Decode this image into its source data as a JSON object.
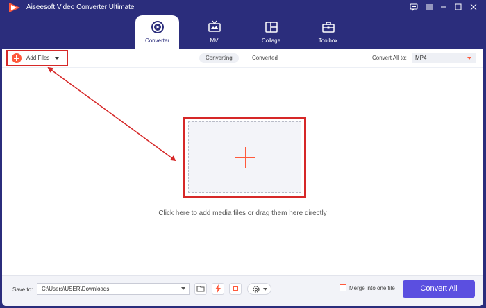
{
  "app": {
    "title": "Aiseesoft Video Converter Ultimate"
  },
  "window_controls": [
    "feedback-icon",
    "menu-icon",
    "minimize-icon",
    "maximize-icon",
    "close-icon"
  ],
  "nav": {
    "tabs": [
      {
        "label": "Converter",
        "icon": "converter-icon",
        "active": true
      },
      {
        "label": "MV",
        "icon": "tv-icon",
        "active": false
      },
      {
        "label": "Collage",
        "icon": "collage-icon",
        "active": false
      },
      {
        "label": "Toolbox",
        "icon": "toolbox-icon",
        "active": false
      }
    ]
  },
  "toolbar": {
    "add_files_label": "Add Files",
    "segments": [
      "Converting",
      "Converted"
    ],
    "active_segment": "Converting",
    "convert_all_label": "Convert All to:",
    "format_value": "MP4"
  },
  "dropzone": {
    "hint": "Click here to add media files or drag them here directly"
  },
  "footer": {
    "save_to_label": "Save to:",
    "save_path": "C:\\Users\\USER\\Downloads",
    "merge_label": "Merge into one file",
    "merge_checked": false,
    "convert_all_button": "Convert All"
  },
  "colors": {
    "accent": "#2b2d7c",
    "brand_orange": "#ff5a3c",
    "highlight_red": "#d62828",
    "convert_button": "#5b4fe0"
  }
}
